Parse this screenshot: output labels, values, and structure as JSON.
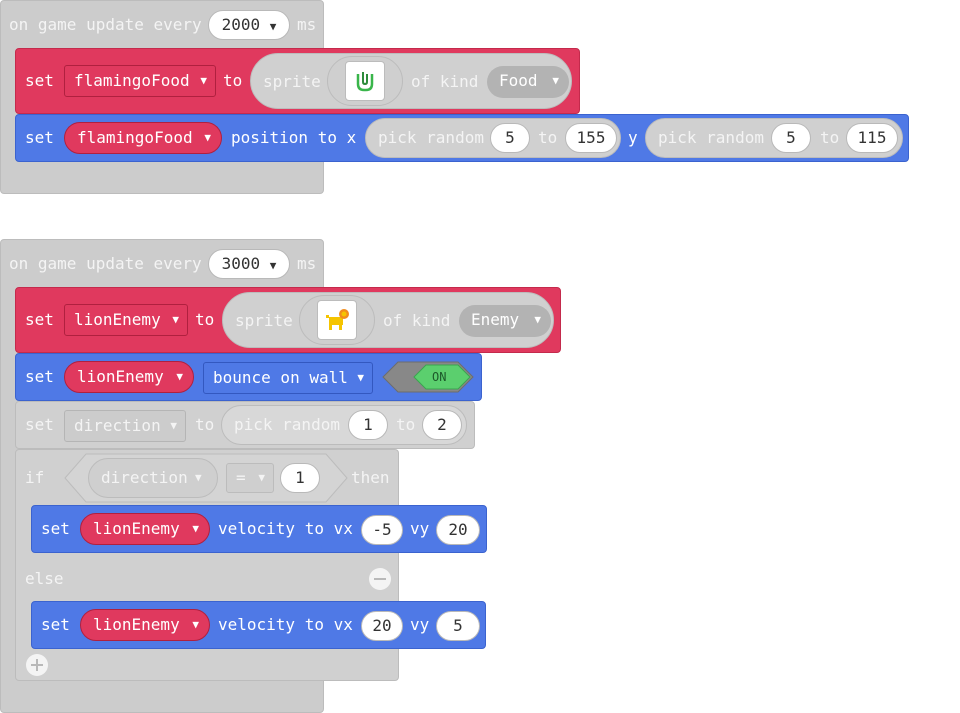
{
  "block1": {
    "hat": {
      "prefix": "on game update every",
      "interval": "2000",
      "unit": "ms"
    },
    "set_sprite": {
      "set": "set",
      "var": "flamingoFood",
      "to": "to",
      "sprite": "sprite",
      "of_kind": "of kind",
      "kind": "Food"
    },
    "set_position": {
      "set": "set",
      "var": "flamingoFood",
      "position_to_x": "position to x",
      "pick1": "pick random",
      "pick1_min": "5",
      "pick1_to": "to",
      "pick1_max": "155",
      "y": "y",
      "pick2": "pick random",
      "pick2_min": "5",
      "pick2_to": "to",
      "pick2_max": "115"
    }
  },
  "block2": {
    "hat": {
      "prefix": "on game update every",
      "interval": "3000",
      "unit": "ms"
    },
    "set_sprite": {
      "set": "set",
      "var": "lionEnemy",
      "to": "to",
      "sprite": "sprite",
      "of_kind": "of kind",
      "kind": "Enemy"
    },
    "bounce": {
      "set": "set",
      "var": "lionEnemy",
      "option": "bounce on wall",
      "toggle": "ON"
    },
    "set_direction": {
      "set": "set",
      "var": "direction",
      "to": "to",
      "pick": "pick random",
      "min": "1",
      "pick_to": "to",
      "max": "2"
    },
    "if_block": {
      "if": "if",
      "var": "direction",
      "op": "=",
      "value": "1",
      "then": "then",
      "else": "else"
    },
    "vel1": {
      "set": "set",
      "var": "lionEnemy",
      "velocity": "velocity to vx",
      "vx": "-5",
      "vy_label": "vy",
      "vy": "20"
    },
    "vel2": {
      "set": "set",
      "var": "lionEnemy",
      "velocity": "velocity to vx",
      "vx": "20",
      "vy_label": "vy",
      "vy": "5"
    }
  },
  "colors": {
    "sprites_red": "#e0395e",
    "blue": "#4f79e6",
    "disabled_grey": "#d0d0d0",
    "toggle_green": "#5bcf6e"
  }
}
